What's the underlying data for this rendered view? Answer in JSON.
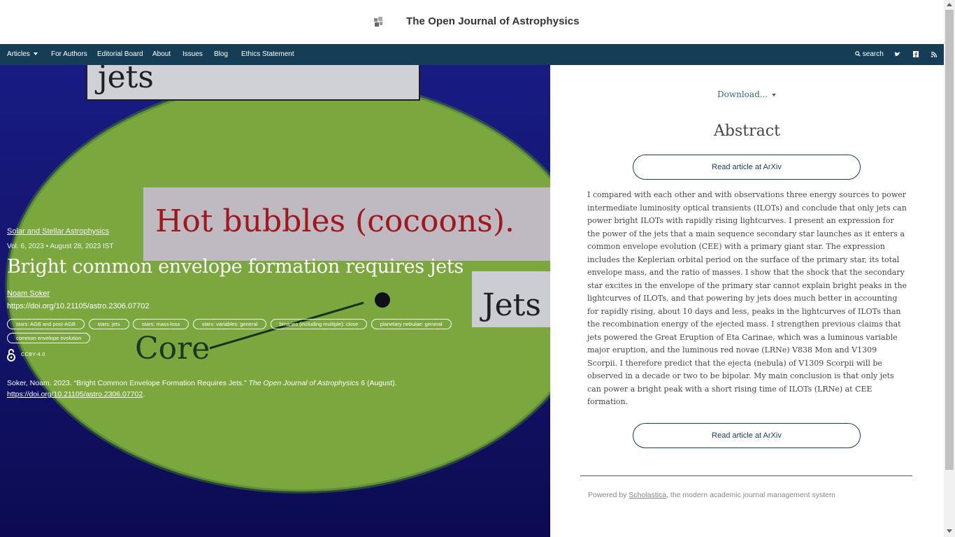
{
  "header": {
    "site_title": "The Open Journal of Astrophysics",
    "logo_icon": "journal-logo-icon"
  },
  "nav": {
    "items": [
      {
        "label": "Articles",
        "has_dropdown": true
      },
      {
        "label": "For Authors"
      },
      {
        "label": "Editorial Board"
      },
      {
        "label": "About"
      },
      {
        "label": "Issues"
      },
      {
        "label": "Blog"
      },
      {
        "label": "Ethics Statement"
      }
    ],
    "search_label": "search",
    "social_icons": [
      "twitter-icon",
      "facebook-icon",
      "rss-icon"
    ]
  },
  "hero": {
    "figure_texts": {
      "top": "jets",
      "middle": "Hot bubbles (cocoons).",
      "right": "Jets",
      "bottom": "Core"
    },
    "subject": "Solar and Stellar Astrophysics",
    "volume": "Vol. 6, 2023 • August 28, 2023 IST",
    "title": "Bright common envelope formation requires jets",
    "author": "Noam Soker",
    "doi": "https://doi.org/10.21105/astro.2306.07702",
    "tags": [
      "stars: AGB and post-AGB",
      "stars: jets",
      "stars: mass-loss",
      "stars: variables: general",
      "binaries (including multiple): close",
      "planetary nebulae: general",
      "common envelope evolution"
    ],
    "license": "CCBY-4.0",
    "citation": {
      "text": "Soker, Noam. 2023. “Bright Common Envelope Formation Requires Jets.”",
      "journal": "The Open Journal of Astrophysics",
      "rest": "6 (August).",
      "link": "https://doi.org/10.21105/astro.2306.07702",
      "trailing": "."
    }
  },
  "right": {
    "download_label": "Download...",
    "abstract_heading": "Abstract",
    "read_button": "Read article at ArXiv",
    "abstract": "I compared with each other and with observations three energy sources to power intermediate luminosity optical transients (ILOTs) and conclude that only jets can power bright ILOTs with rapidly rising lightcurves. I present an expression for the power of the jets that a main sequence secondary star launches as it enters a common envelope evolution (CEE) with a primary giant star. The expression includes the Keplerian orbital period on the surface of the primary star, its total envelope mass, and the ratio of masses. I show that the shock that the secondary star excites in the envelope of the primary star cannot explain bright peaks in the lightcurves of ILOTs, and that powering by jets does much better in accounting for rapidly rising, about 10 days and less, peaks in the lightcurves of ILOTs than the recombination energy of the ejected mass. I strengthen previous claims that jets powered the Great Eruption of Eta Carinae, which was a luminous variable major eruption, and the luminous red novae (LRNe) V838 Mon and V1309 Scorpii. I therefore predict that the ejecta (nebula) of V1309 Scorpii will be observed in a decade or two to be bipolar. My main conclusion is that only jets can power a bright peak with a short rising time of ILOTs (LRNe) at CEE formation.",
    "footer": {
      "prefix": "Powered by ",
      "link": "Scholastica",
      "suffix": ", the modern academic journal management system"
    }
  },
  "colors": {
    "nav_bg": "#163d56",
    "hero_bg": "#1b1e8c",
    "ellipse": "#8bbd3f",
    "accent_link": "#2c6a8e"
  }
}
